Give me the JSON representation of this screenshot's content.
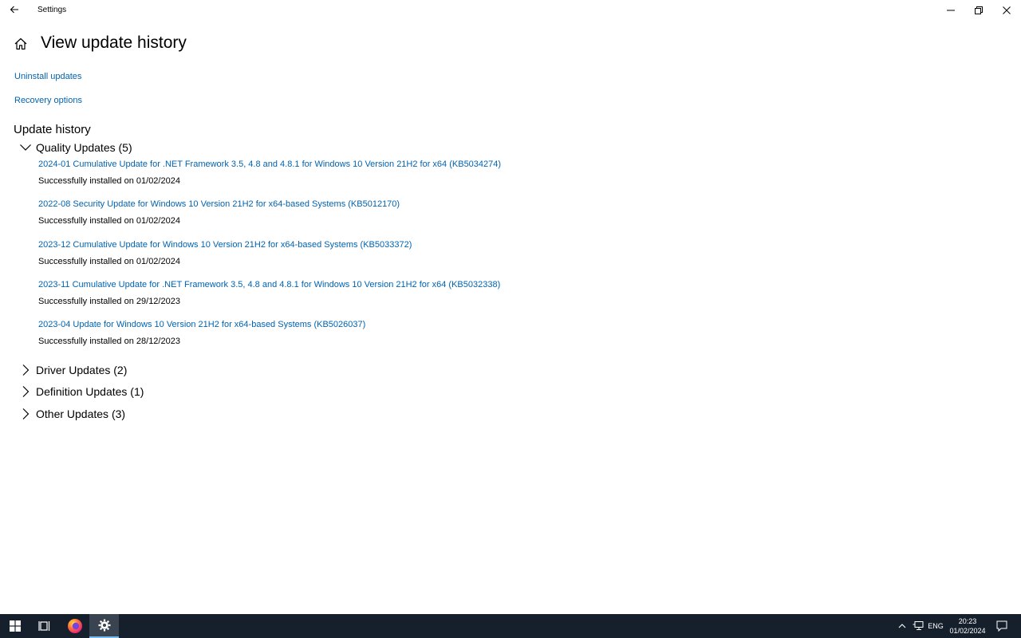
{
  "window": {
    "title": "Settings",
    "back_icon": "back-arrow-icon",
    "controls": [
      "minimize-icon",
      "restore-icon",
      "close-icon"
    ]
  },
  "header": {
    "home_icon": "home-icon",
    "title": "View update history"
  },
  "links": {
    "uninstall": "Uninstall updates",
    "recovery": "Recovery options"
  },
  "history": {
    "title": "Update history",
    "groups": [
      {
        "label": "Quality Updates (5)",
        "expanded": true
      },
      {
        "label": "Driver Updates (2)",
        "expanded": false
      },
      {
        "label": "Definition Updates (1)",
        "expanded": false
      },
      {
        "label": "Other Updates (3)",
        "expanded": false
      }
    ],
    "quality_updates": [
      {
        "name": "2024-01 Cumulative Update for .NET Framework 3.5, 4.8 and 4.8.1 for Windows 10 Version 21H2 for x64 (KB5034274)",
        "status": "Successfully installed on 01/02/2024"
      },
      {
        "name": "2022-08 Security Update for Windows 10 Version 21H2 for x64-based Systems (KB5012170)",
        "status": "Successfully installed on 01/02/2024"
      },
      {
        "name": "2023-12 Cumulative Update for Windows 10 Version 21H2 for x64-based Systems (KB5033372)",
        "status": "Successfully installed on 01/02/2024"
      },
      {
        "name": "2023-11 Cumulative Update for .NET Framework 3.5, 4.8 and 4.8.1 for Windows 10 Version 21H2 for x64 (KB5032338)",
        "status": "Successfully installed on 29/12/2023"
      },
      {
        "name": "2023-04 Update for Windows 10 Version 21H2 for x64-based Systems (KB5026037)",
        "status": "Successfully installed on 28/12/2023"
      }
    ]
  },
  "taskbar": {
    "apps": [
      "windows-start-icon",
      "task-view-icon",
      "firefox-icon",
      "settings-gear-icon"
    ],
    "active_app": "Settings",
    "language": "ENG",
    "time": "20:23",
    "date": "01/02/2024"
  },
  "colors": {
    "link": "#0063b1",
    "taskbar": "#16202c",
    "taskbar_active": "#3a4350"
  }
}
